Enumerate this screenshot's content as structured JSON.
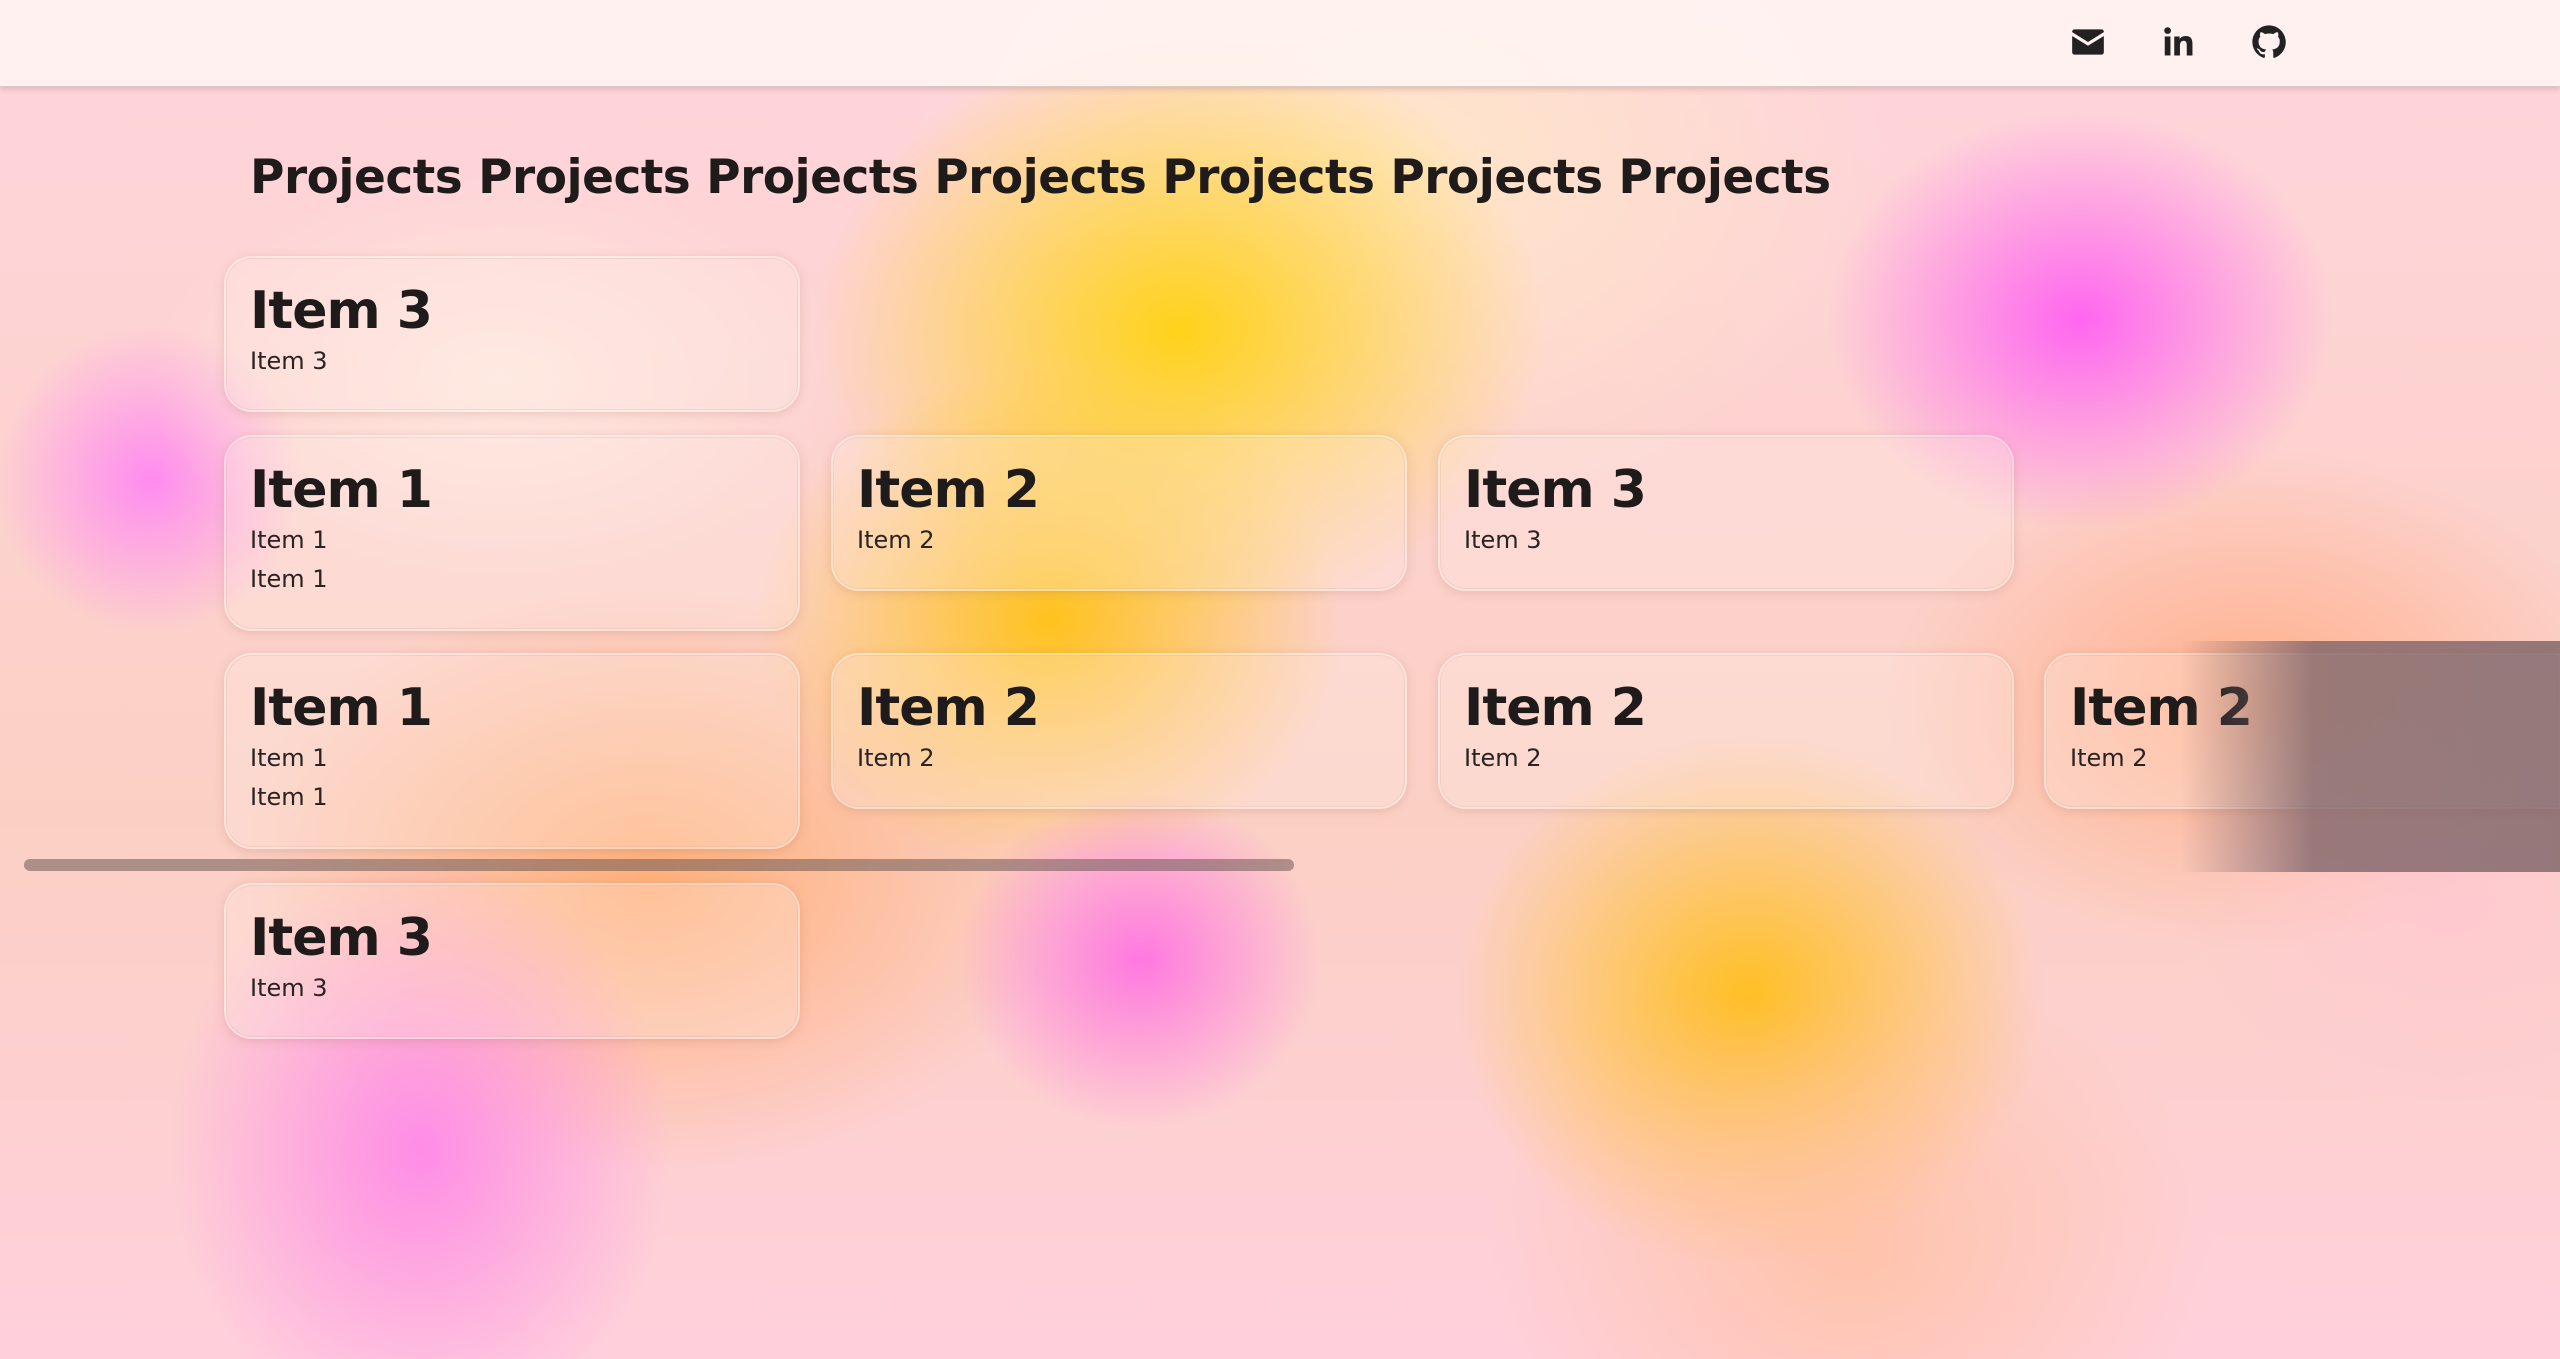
{
  "header": {
    "social": [
      {
        "name": "mail-icon"
      },
      {
        "name": "linkedin-icon"
      },
      {
        "name": "github-icon"
      }
    ]
  },
  "main": {
    "title": "Projects Projects Projects Projects Projects Projects Projects",
    "rows": [
      {
        "cards": [
          {
            "title": "Item 3",
            "lines": [
              "Item 3"
            ]
          }
        ]
      },
      {
        "cards": [
          {
            "title": "Item 1",
            "lines": [
              "Item 1",
              "Item 1"
            ]
          },
          {
            "title": "Item 2",
            "lines": [
              "Item 2"
            ]
          },
          {
            "title": "Item 3",
            "lines": [
              "Item 3"
            ]
          }
        ]
      },
      {
        "cards": [
          {
            "title": "Item 1",
            "lines": [
              "Item 1",
              "Item 1"
            ]
          },
          {
            "title": "Item 2",
            "lines": [
              "Item 2"
            ]
          },
          {
            "title": "Item 2",
            "lines": [
              "Item 2"
            ]
          },
          {
            "title": "Item 2",
            "lines": [
              "Item 2"
            ]
          }
        ]
      },
      {
        "cards": [
          {
            "title": "Item 3",
            "lines": [
              "Item 3"
            ]
          }
        ]
      }
    ]
  }
}
